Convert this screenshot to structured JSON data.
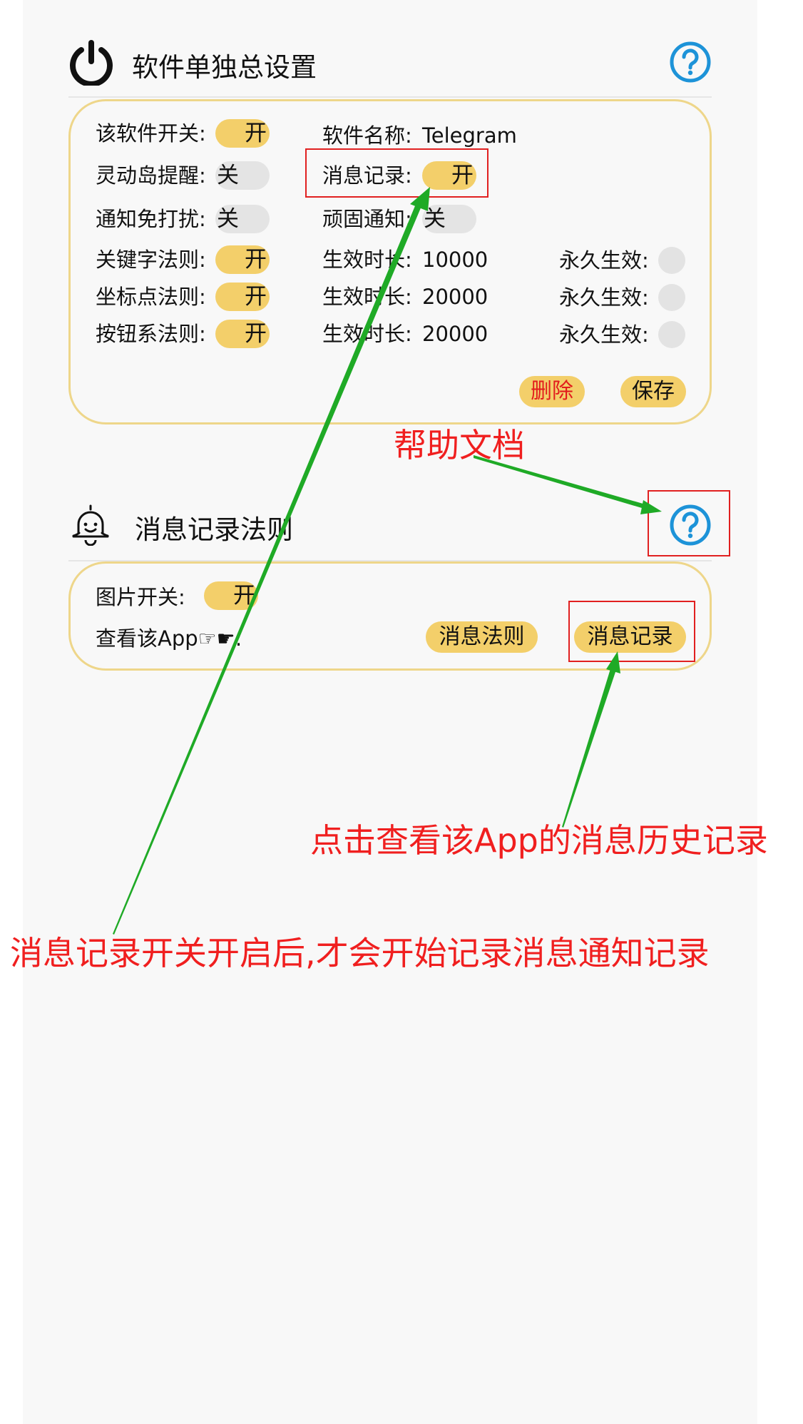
{
  "section1": {
    "title": "软件单独总设置",
    "icons": {
      "main": "power-icon",
      "help": "help-circle-icon"
    },
    "rows": {
      "app_switch": {
        "label": "该软件开关:",
        "toggle": "开"
      },
      "app_name": {
        "label": "软件名称:",
        "value": "Telegram"
      },
      "island_reminder": {
        "label": "灵动岛提醒:",
        "toggle": "关"
      },
      "message_record": {
        "label": "消息记录:",
        "toggle": "开"
      },
      "dnd": {
        "label": "通知免打扰:",
        "toggle": "关"
      },
      "persistent": {
        "label": "顽固通知:",
        "toggle": "关"
      },
      "keyword_rule": {
        "label": "关键字法则:",
        "toggle": "开",
        "duration_label": "生效时长:",
        "duration": "10000",
        "permanent_label": "永久生效:"
      },
      "coordinate_rule": {
        "label": "坐标点法则:",
        "toggle": "开",
        "duration_label": "生效时长:",
        "duration": "20000",
        "permanent_label": "永久生效:"
      },
      "button_rule": {
        "label": "按钮系法则:",
        "toggle": "开",
        "duration_label": "生效时长:",
        "duration": "20000",
        "permanent_label": "永久生效:"
      }
    },
    "delete_label": "删除",
    "save_label": "保存"
  },
  "section2": {
    "title": "消息记录法则",
    "icons": {
      "main": "bell-icon",
      "help": "help-circle-icon"
    },
    "image_switch": {
      "label": "图片开关:",
      "toggle": "开"
    },
    "view_app": {
      "label": "查看该App☞☛:"
    },
    "message_rules_label": "消息法则",
    "message_records_label": "消息记录"
  },
  "annotations": {
    "help_doc": "帮助文档",
    "view_history": "点击查看该App的消息历史记录",
    "record_switch_note": "消息记录开关开启后,才会开始记录消息通知记录"
  },
  "colors": {
    "toggle_on": "#f3cf6a",
    "toggle_off": "#e4e4e4",
    "card_border": "#eed68a",
    "help_blue": "#1d93d8",
    "annotation_red": "#f01f1f",
    "arrow_green": "#1faa26"
  }
}
